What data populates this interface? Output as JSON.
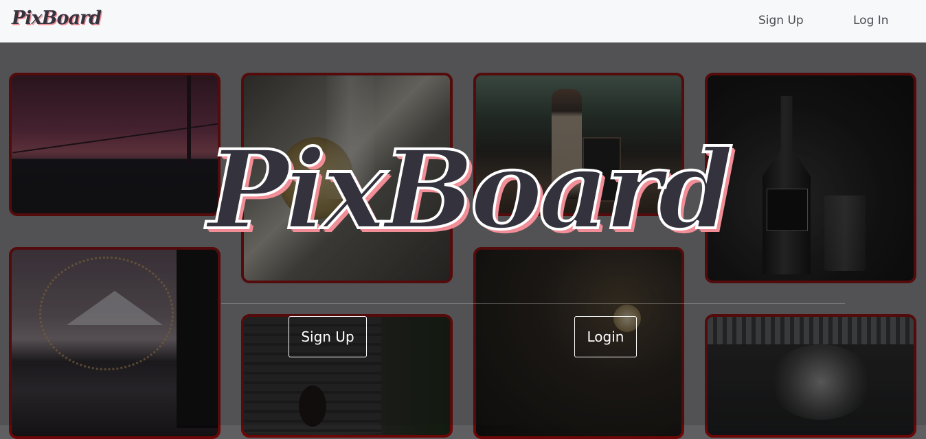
{
  "navbar": {
    "logo": "PixBoard",
    "links": {
      "signup": "Sign Up",
      "login": "Log In"
    }
  },
  "hero": {
    "title": "PixBoard",
    "buttons": {
      "signup": "Sign Up",
      "login": "Login"
    }
  },
  "colors": {
    "tile_border": "#6c0707",
    "logo_fill": "#33323d",
    "logo_shadow": "#f08d96",
    "navbar_bg": "#f7f8fa"
  }
}
